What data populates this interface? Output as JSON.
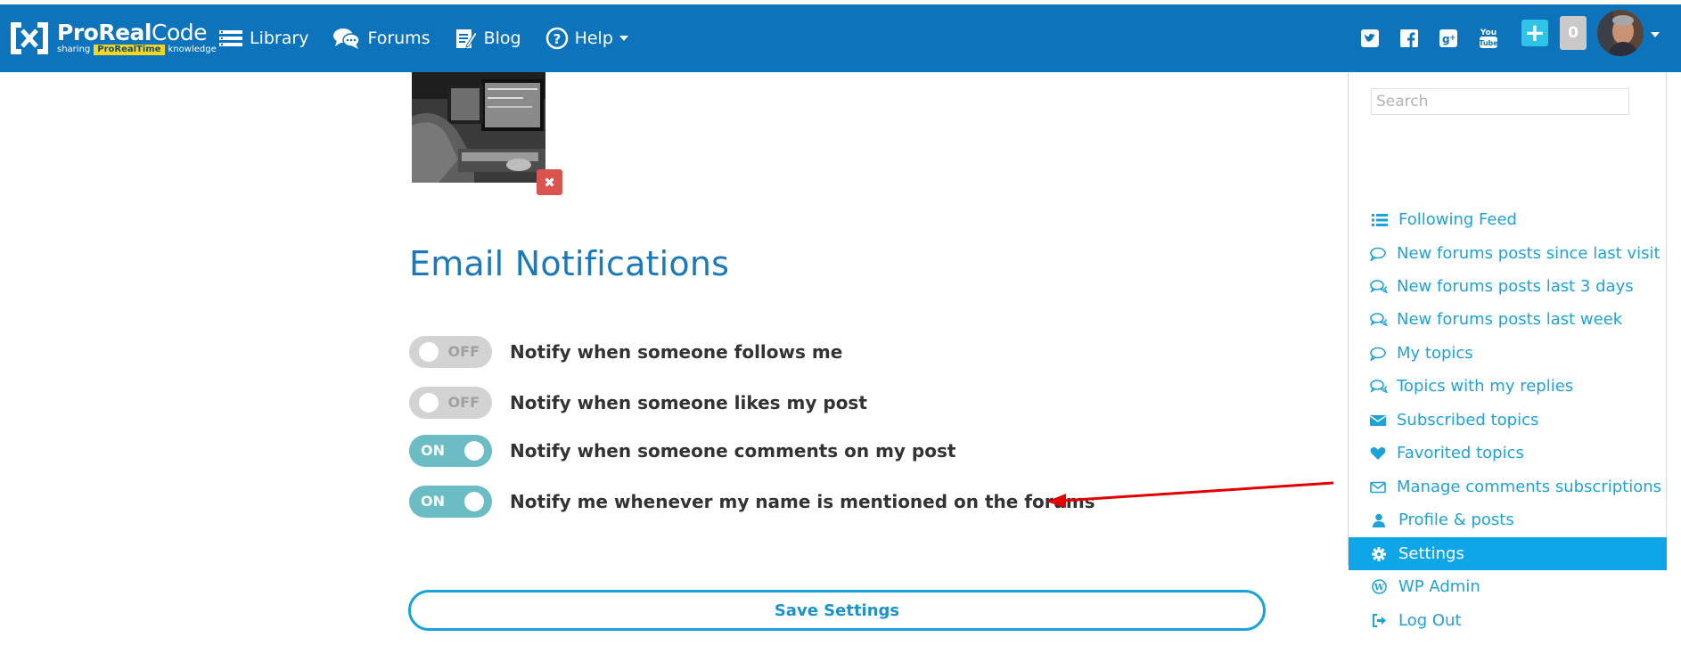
{
  "brand": {
    "name_bold": "ProReal",
    "name_light": "Code",
    "tagline_left": "sharing",
    "tagline_highlight": "ProRealTime",
    "tagline_right": "knowledge"
  },
  "nav": {
    "items": [
      {
        "label": "Library",
        "icon": "library-icon"
      },
      {
        "label": "Forums",
        "icon": "forums-icon"
      },
      {
        "label": "Blog",
        "icon": "blog-icon"
      },
      {
        "label": "Help",
        "icon": "help-icon"
      }
    ],
    "social": [
      "twitter-icon",
      "facebook-icon",
      "google-plus-icon",
      "youtube-icon"
    ],
    "plus_label": "+",
    "notification_count": "0"
  },
  "notifications": {
    "title": "Email Notifications",
    "items": [
      {
        "state": "OFF",
        "label": "Notify when someone follows me"
      },
      {
        "state": "OFF",
        "label": "Notify when someone likes my post"
      },
      {
        "state": "ON",
        "label": "Notify when someone comments on my post"
      },
      {
        "state": "ON",
        "label": "Notify me whenever my name is mentioned on the forums"
      }
    ],
    "save_label": "Save Settings",
    "remove_photo_label": "✖"
  },
  "menu": {
    "search_placeholder": "Search",
    "items": [
      {
        "label": "Following Feed",
        "icon": "list-icon"
      },
      {
        "label": "New forums posts since last visit",
        "icon": "comment-icon"
      },
      {
        "label": "New forums posts last 3 days",
        "icon": "comments-icon"
      },
      {
        "label": "New forums posts last week",
        "icon": "comments-icon"
      },
      {
        "label": "My topics",
        "icon": "comment-icon"
      },
      {
        "label": "Topics with my replies",
        "icon": "comments-icon"
      },
      {
        "label": "Subscribed topics",
        "icon": "envelope-icon"
      },
      {
        "label": "Favorited topics",
        "icon": "heart-icon"
      },
      {
        "label": "Manage comments subscriptions",
        "icon": "envelope-outline-icon"
      },
      {
        "label": "Profile & posts",
        "icon": "user-icon"
      },
      {
        "label": "Settings",
        "icon": "gear-icon",
        "active": true
      },
      {
        "label": "WP Admin",
        "icon": "wordpress-icon"
      },
      {
        "label": "Log Out",
        "icon": "logout-icon"
      }
    ]
  },
  "colors": {
    "navbar": "#0d74bb",
    "menu_link": "#1ea3d9",
    "menu_active": "#0ea6e6",
    "toggle_on": "#6bbcc4",
    "toggle_off": "#d3d3d3",
    "title": "#1a7ab9",
    "annotation_arrow": "#e00000"
  }
}
